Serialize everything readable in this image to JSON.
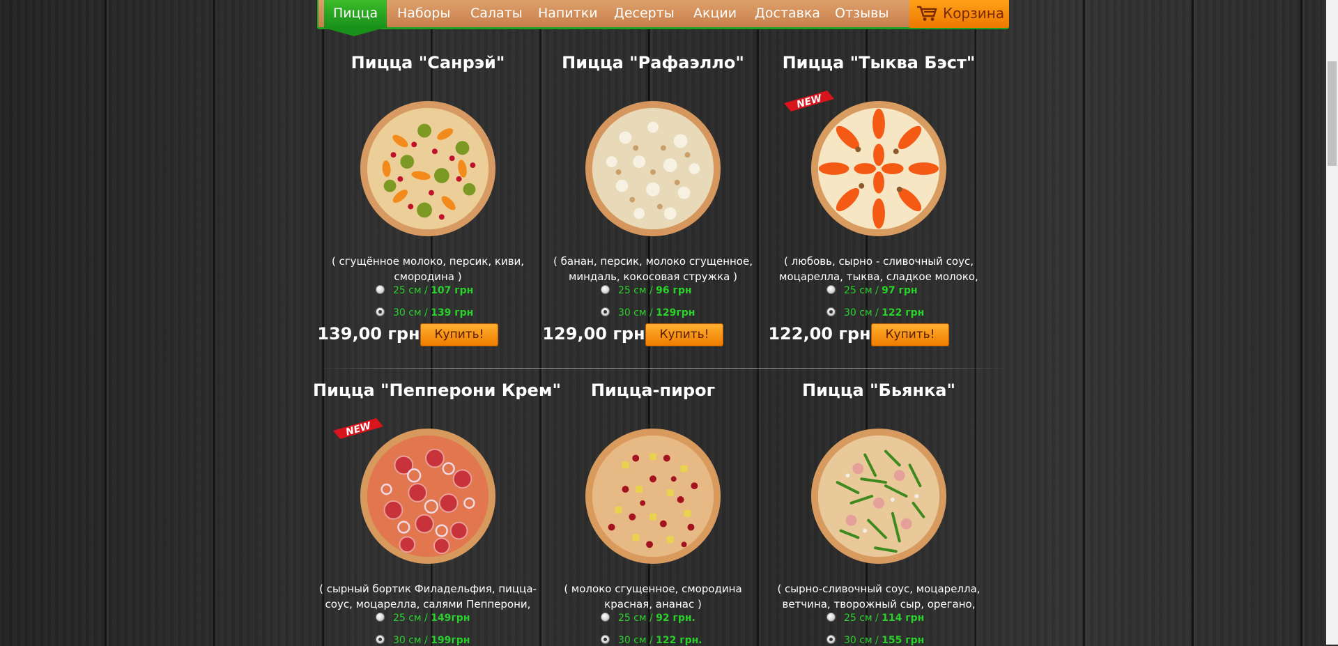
{
  "nav": {
    "items": [
      "Пицца",
      "Наборы",
      "Салаты",
      "Напитки",
      "Десерты",
      "Акции",
      "Доставка",
      "Отзывы"
    ],
    "active_index": 0,
    "cart_label": "Корзина"
  },
  "products": [
    {
      "title": "Пицца \"Санрэй\"",
      "desc_line1": "( сгущённое молоко, персик, киви,",
      "desc_line2": "смородина )",
      "new_badge": false,
      "options": [
        {
          "size": "25 см /",
          "price": "107 грн",
          "checked": false
        },
        {
          "size": "30 см /",
          "price": "139 грн",
          "checked": true
        }
      ],
      "price": "139,00 грн",
      "buy_label": "Купить!"
    },
    {
      "title": "Пицца \"Рафаэлло\"",
      "desc_line1": "( банан, персик,  молоко сгущенное,",
      "desc_line2": "миндаль, кокосовая стружка )",
      "new_badge": false,
      "options": [
        {
          "size": "25 см /",
          "price": "96 грн",
          "checked": false
        },
        {
          "size": "30 см /",
          "price": "129грн",
          "checked": true
        }
      ],
      "price": "129,00 грн",
      "buy_label": "Купить!"
    },
    {
      "title": "Пицца \"Тыква Бэст\"",
      "desc_line1": "( любовь, сырно - сливочный соус,",
      "desc_line2": "моцарелла, тыква, сладкое молоко,",
      "new_badge": true,
      "options": [
        {
          "size": "25 см /",
          "price": "97 грн",
          "checked": false
        },
        {
          "size": "30 см /",
          "price": "122 грн",
          "checked": true
        }
      ],
      "price": "122,00 грн",
      "buy_label": "Купить!"
    },
    {
      "title": "Пицца \"Пепперони Крем\"",
      "desc_line1": "( сырный бортик Филадельфия, пицца-",
      "desc_line2": "соус, моцарелла, салями Пепперони,",
      "new_badge": true,
      "options": [
        {
          "size": "25 см /",
          "price": "149грн",
          "checked": false
        },
        {
          "size": "30 см /",
          "price": "199грн",
          "checked": true
        }
      ]
    },
    {
      "title": "Пицца-пирог",
      "desc_line1": "( молоко сгущенное, смородина",
      "desc_line2": "красная, ананас )",
      "new_badge": false,
      "options": [
        {
          "size": "25 см /",
          "price": "92 грн.",
          "checked": false
        },
        {
          "size": "30 см /",
          "price": "122 грн.",
          "checked": true
        }
      ]
    },
    {
      "title": "Пицца \"Бьянка\"",
      "desc_line1": "( сырно-сливочный соус, моцарелла,",
      "desc_line2": "ветчина, творожный сыр, орегано,",
      "new_badge": false,
      "options": [
        {
          "size": "25 см /",
          "price": "114 грн",
          "checked": false
        },
        {
          "size": "30 см /",
          "price": "155 грн",
          "checked": true
        }
      ]
    }
  ],
  "new_badge_label": "NEW",
  "colors": {
    "nav_bg": "#d28e5a",
    "nav_active": "#2aa82a",
    "cart_bg": "#f88c0c",
    "price_green": "#2bd12b",
    "buy_bg": "#f79a17"
  }
}
